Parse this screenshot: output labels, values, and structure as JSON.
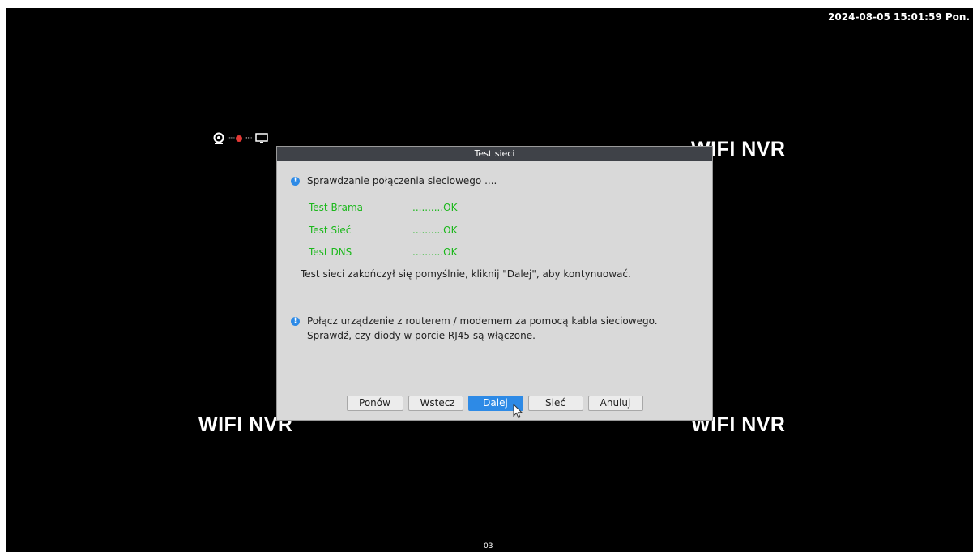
{
  "overlay": {
    "datetime": "2024-08-05 15:01:59 Pon.",
    "watermark": "WIFI NVR",
    "channel": "03"
  },
  "dialog": {
    "title": "Test sieci",
    "checking_text": "Sprawdzanie połączenia sieciowego ....",
    "tests": [
      {
        "label": "Test Brama",
        "result": "..........OK"
      },
      {
        "label": "Test Sieć",
        "result": "..........OK"
      },
      {
        "label": "Test DNS",
        "result": "..........OK"
      }
    ],
    "summary": "Test sieci zakończył się pomyślnie, kliknij \"Dalej\", aby kontynuować.",
    "note": "Połącz urządzenie z routerem / modemem za pomocą kabla sieciowego. Sprawdź, czy diody w porcie RJ45 są włączone.",
    "buttons": {
      "retry": "Ponów",
      "back": "Wstecz",
      "next": "Dalej",
      "network": "Sieć",
      "cancel": "Anuluj"
    }
  },
  "colors": {
    "ok_green": "#1bb81b",
    "accent_blue": "#2d8ae6",
    "title_bar": "#3f4248",
    "dialog_bg": "#d9d9d9"
  },
  "icons": [
    "camera-icon",
    "disconnected-icon",
    "monitor-icon",
    "info-icon",
    "mouse-cursor-icon"
  ]
}
